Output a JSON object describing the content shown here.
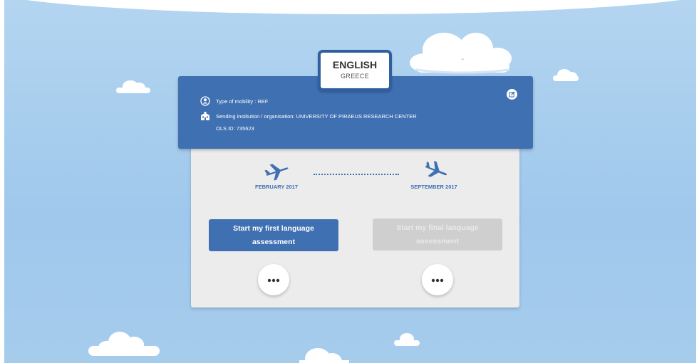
{
  "language": {
    "name": "ENGLISH",
    "country": "GREECE"
  },
  "mobility": {
    "type_text": "Type of mobility : REF",
    "institution_text": "Sending institution / organisation: UNIVERSITY OF PIRAEUS RESEARCH CENTER",
    "ols_id_text": "OLS ID: 735623"
  },
  "timeline": {
    "start_date": "FEBRUARY 2017",
    "end_date": "SEPTEMBER 2017"
  },
  "actions": {
    "first_assessment_label": "Start my first language assessment",
    "final_assessment_label": "Start my final language assessment",
    "first_assessment_enabled": true,
    "final_assessment_enabled": false
  },
  "icons": {
    "person": "person-icon",
    "institution": "building-icon",
    "edit": "edit-icon",
    "departure": "airplane-departure-icon",
    "arrival": "airplane-arrival-icon",
    "more": "more-icon"
  },
  "colors": {
    "primary": "#3f70b2",
    "sky": "#a6ccec",
    "card": "#ececec",
    "disabled": "#cfcfcf"
  }
}
